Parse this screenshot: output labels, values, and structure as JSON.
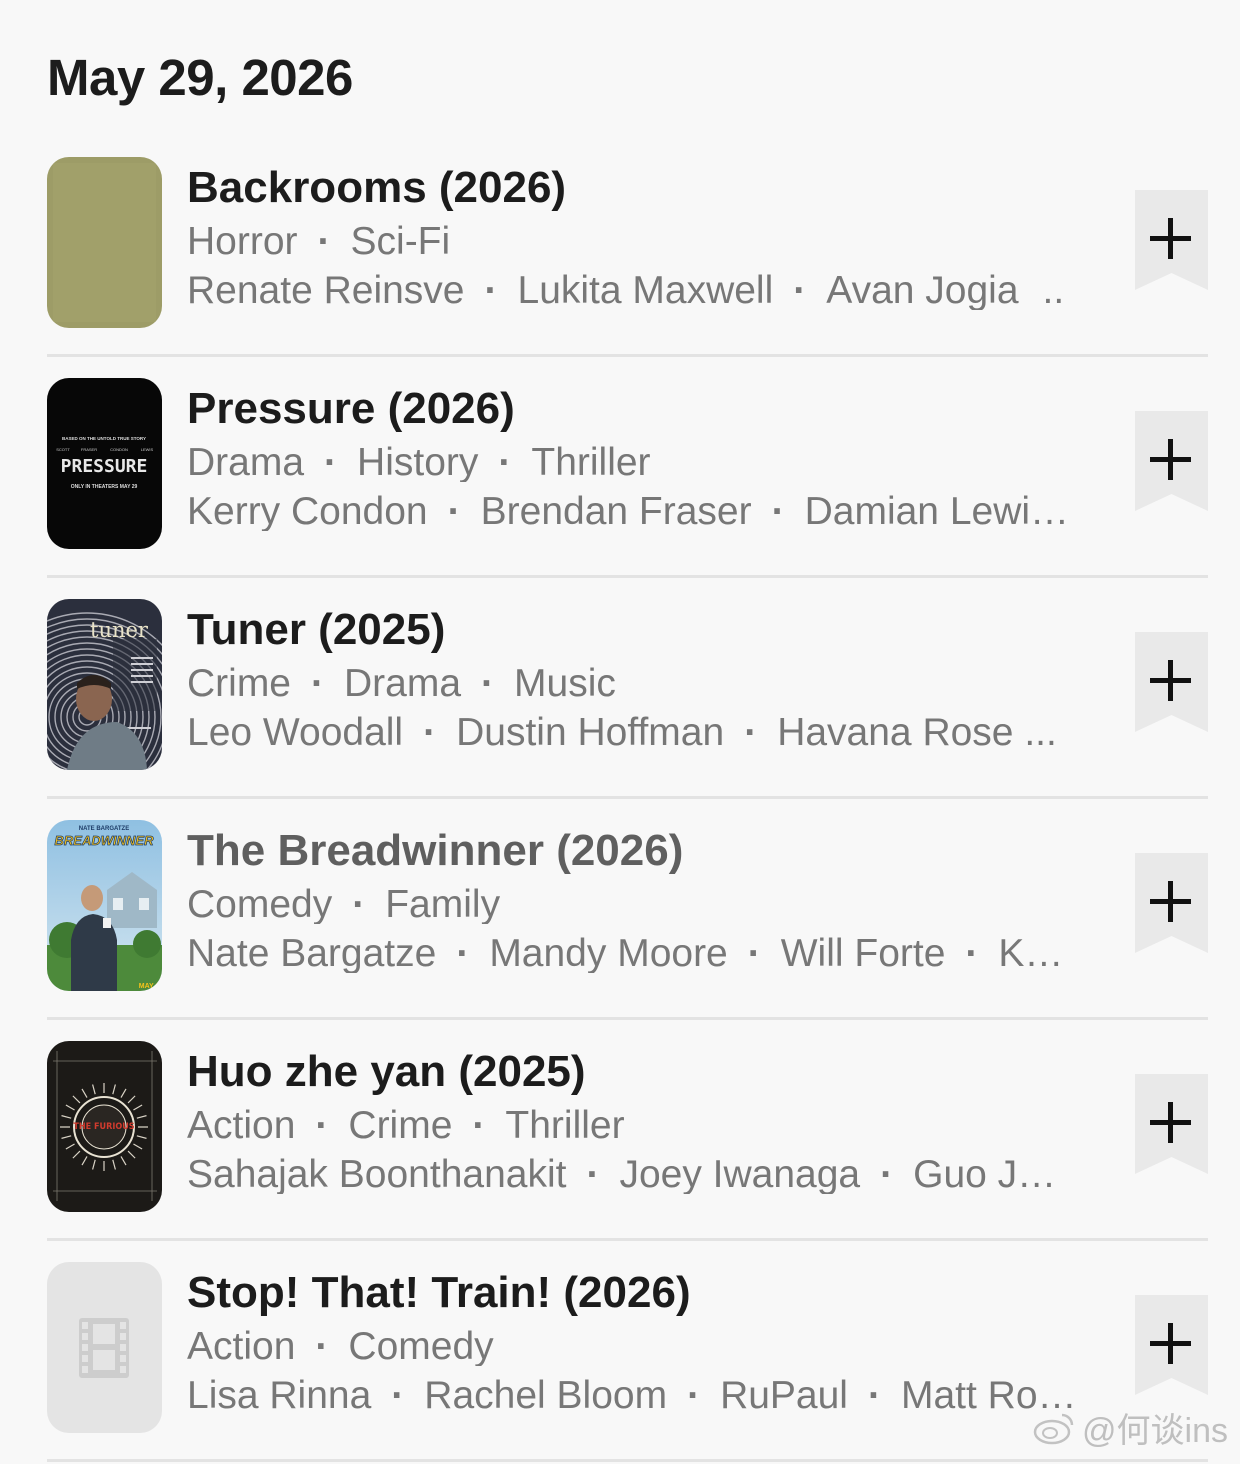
{
  "date_header": "May 29, 2026",
  "movies": [
    {
      "title": "Backrooms (2026)",
      "genres": [
        "Horror",
        "Sci-Fi"
      ],
      "cast": [
        "Renate Reinsve",
        "Lukita Maxwell",
        "Avan Jogia"
      ],
      "cast_more": "..",
      "poster": "plain-olive"
    },
    {
      "title": "Pressure (2026)",
      "genres": [
        "Drama",
        "History",
        "Thriller"
      ],
      "cast": [
        "Kerry Condon",
        "Brendan Fraser",
        "Damian Lewi…"
      ],
      "cast_more": "",
      "poster": "pressure",
      "poster_text": {
        "top": "BASED ON THE UNTOLD TRUE STORY",
        "names": [
          "SCOTT",
          "FRASER",
          "CONDON",
          "LEWIS"
        ],
        "title": "PRESSURE",
        "tagline": "ONLY IN THEATERS MAY 29"
      }
    },
    {
      "title": "Tuner (2025)",
      "genres": [
        "Crime",
        "Drama",
        "Music"
      ],
      "cast": [
        "Leo Woodall",
        "Dustin Hoffman",
        "Havana Rose ..."
      ],
      "cast_more": "",
      "poster": "tuner",
      "poster_text": {
        "title": "tuner"
      }
    },
    {
      "title": "The Breadwinner (2026)",
      "genres": [
        "Comedy",
        "Family"
      ],
      "cast": [
        "Nate Bargatze",
        "Mandy Moore",
        "Will Forte",
        "K…"
      ],
      "cast_more": "",
      "poster": "breadwinner",
      "muted": true,
      "poster_text": {
        "top": "NATE BARGATZE",
        "title": "BREADWINNER",
        "date": "MAY 29"
      }
    },
    {
      "title": "Huo zhe yan (2025)",
      "genres": [
        "Action",
        "Crime",
        "Thriller"
      ],
      "cast": [
        "Sahajak Boonthanakit",
        "Joey Iwanaga",
        "Guo J…"
      ],
      "cast_more": "",
      "poster": "furious",
      "poster_text": {
        "title": "THE FURIOUS"
      }
    },
    {
      "title": "Stop! That! Train! (2026)",
      "genres": [
        "Action",
        "Comedy"
      ],
      "cast": [
        "Lisa Rinna",
        "Rachel Bloom",
        "RuPaul",
        "Matt Ro…"
      ],
      "cast_more": "",
      "poster": "placeholder"
    }
  ],
  "add_button_label": "+",
  "separator": "·",
  "watermark": "@何谈ins",
  "colors": {
    "background": "#f8f8f8",
    "title": "#1c1c1c",
    "meta": "#777777",
    "add_button_bg": "#e9e9e9"
  }
}
